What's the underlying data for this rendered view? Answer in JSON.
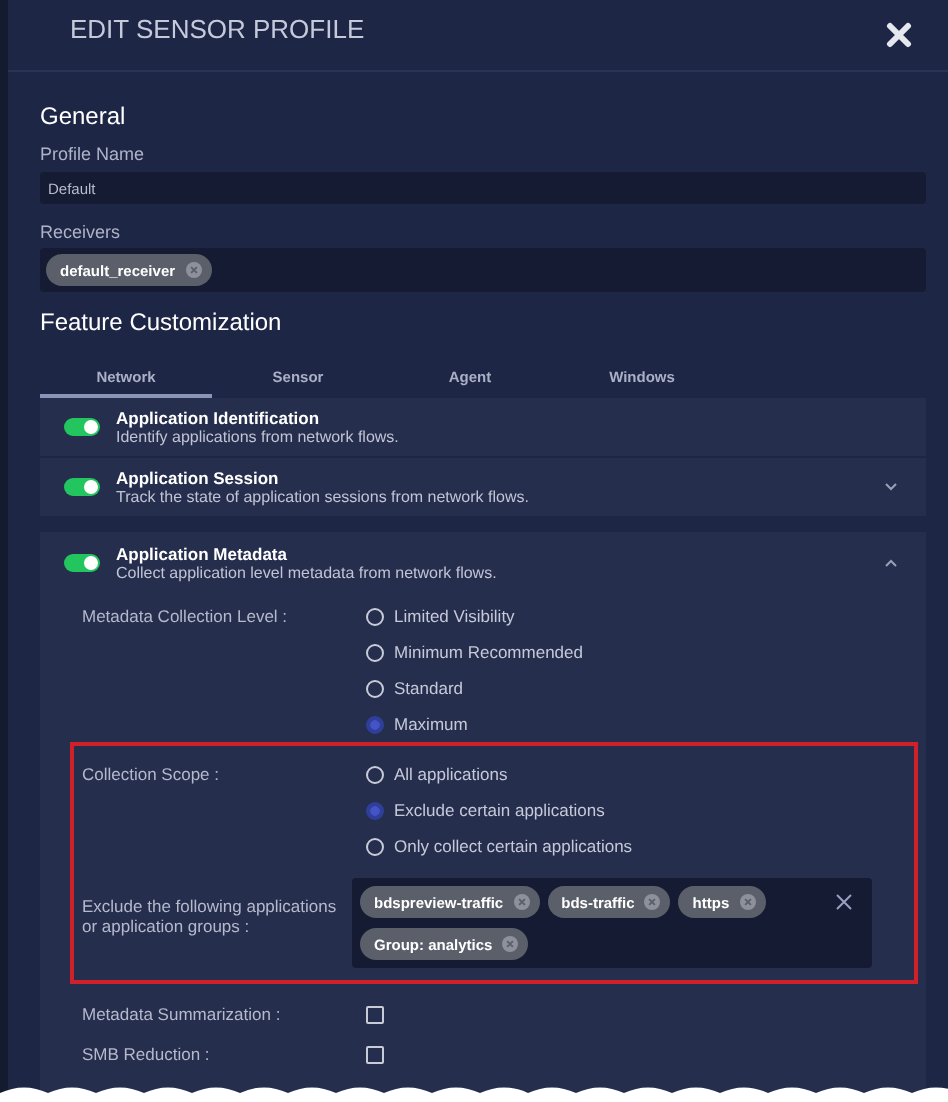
{
  "dialog": {
    "title": "EDIT SENSOR PROFILE"
  },
  "general": {
    "heading": "General",
    "profile_name": {
      "label": "Profile Name",
      "value": "Default"
    },
    "receivers": {
      "label": "Receivers",
      "tags": [
        "default_receiver"
      ]
    }
  },
  "feature_customization": {
    "heading": "Feature Customization",
    "tabs": [
      {
        "label": "Network",
        "selected": true
      },
      {
        "label": "Sensor",
        "selected": false
      },
      {
        "label": "Agent",
        "selected": false
      },
      {
        "label": "Windows",
        "selected": false
      }
    ],
    "features": [
      {
        "kind": "simple",
        "title": "Application Identification",
        "description": "Identify applications from network flows.",
        "on": true,
        "expanded": false
      },
      {
        "kind": "expandable",
        "title": "Application Session",
        "description": "Track the state of application sessions from network flows.",
        "on": true,
        "expanded": false
      },
      {
        "kind": "expandable",
        "title": "Application Metadata",
        "description": "Collect application level metadata from network flows.",
        "on": true,
        "expanded": true
      }
    ],
    "settings": [
      {
        "kind": "radio",
        "label": "Metadata Collection Level :",
        "highlighted": false,
        "options": [
          {
            "label": "Limited Visibility",
            "selected": false
          },
          {
            "label": "Minimum Recommended",
            "selected": false
          },
          {
            "label": "Standard",
            "selected": false
          },
          {
            "label": "Maximum",
            "selected": true
          }
        ]
      },
      {
        "kind": "radio",
        "label": "Collection Scope :",
        "highlighted": true,
        "options": [
          {
            "label": "All applications",
            "selected": false
          },
          {
            "label": "Exclude certain applications",
            "selected": true
          },
          {
            "label": "Only collect certain applications",
            "selected": false
          }
        ]
      },
      {
        "kind": "tags",
        "label": "Exclude the following applications or application groups :",
        "highlighted": true,
        "tags": [
          "bdspreview-traffic",
          "bds-traffic",
          "https",
          "Group: analytics"
        ]
      },
      {
        "kind": "checkbox",
        "label": "Metadata Summarization :",
        "highlighted": false,
        "checked": false
      },
      {
        "kind": "checkbox",
        "label": "SMB Reduction :",
        "highlighted": false,
        "checked": false
      }
    ]
  }
}
